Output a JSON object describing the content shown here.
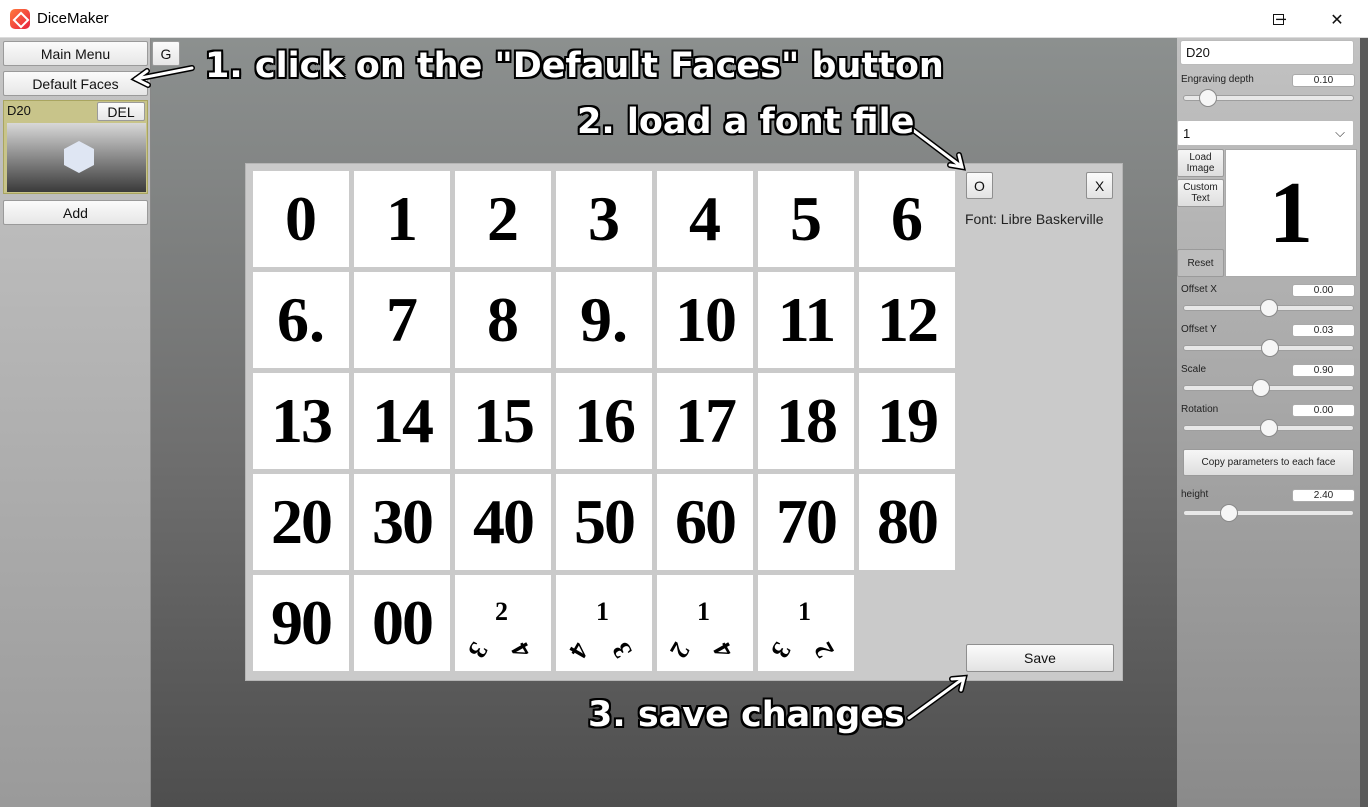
{
  "window": {
    "title": "DiceMaker",
    "controls": {
      "minimize": "─",
      "maximize": "☐",
      "close": "✕"
    }
  },
  "left_panel": {
    "main_menu_label": "Main Menu",
    "g_label": "G",
    "default_faces_label": "Default Faces",
    "die": {
      "name": "D20",
      "delete_label": "DEL"
    },
    "add_label": "Add"
  },
  "modal": {
    "open_label": "O",
    "close_label": "X",
    "font_label": "Font: Libre Baskerville",
    "save_label": "Save",
    "faces": [
      "0",
      "1",
      "2",
      "3",
      "4",
      "5",
      "6",
      "6.",
      "7",
      "8",
      "9.",
      "10",
      "11",
      "12",
      "13",
      "14",
      "15",
      "16",
      "17",
      "18",
      "19",
      "20",
      "30",
      "40",
      "50",
      "60",
      "70",
      "80",
      "90",
      "00"
    ],
    "special_faces": [
      {
        "top": "2",
        "left": "3",
        "right": "4"
      },
      {
        "top": "1",
        "left": "4",
        "right": "3"
      },
      {
        "top": "1",
        "left": "2",
        "right": "4"
      },
      {
        "top": "1",
        "left": "3",
        "right": "2"
      }
    ]
  },
  "right_panel": {
    "name_value": "D20",
    "engraving_depth": {
      "label": "Engraving depth",
      "value": "0.10",
      "level": 0.1
    },
    "face_select": {
      "value": "1"
    },
    "load_image_label": "Load Image",
    "custom_text_label": "Custom Text",
    "reset_label": "Reset",
    "preview_text": "1",
    "offset_x": {
      "label": "Offset X",
      "value": "0.00",
      "level": 0.5
    },
    "offset_y": {
      "label": "Offset Y",
      "value": "0.03",
      "level": 0.51
    },
    "scale": {
      "label": "Scale",
      "value": "0.90",
      "level": 0.45
    },
    "rotation": {
      "label": "Rotation",
      "value": "0.00",
      "level": 0.5
    },
    "copy_params_label": "Copy parameters to each face",
    "height": {
      "label": "height",
      "value": "2.40",
      "level": 0.24
    }
  },
  "annotations": {
    "step1": "1. click on the \"Default Faces\" button",
    "step2": "2. load a font file",
    "step3": "3. save changes"
  }
}
